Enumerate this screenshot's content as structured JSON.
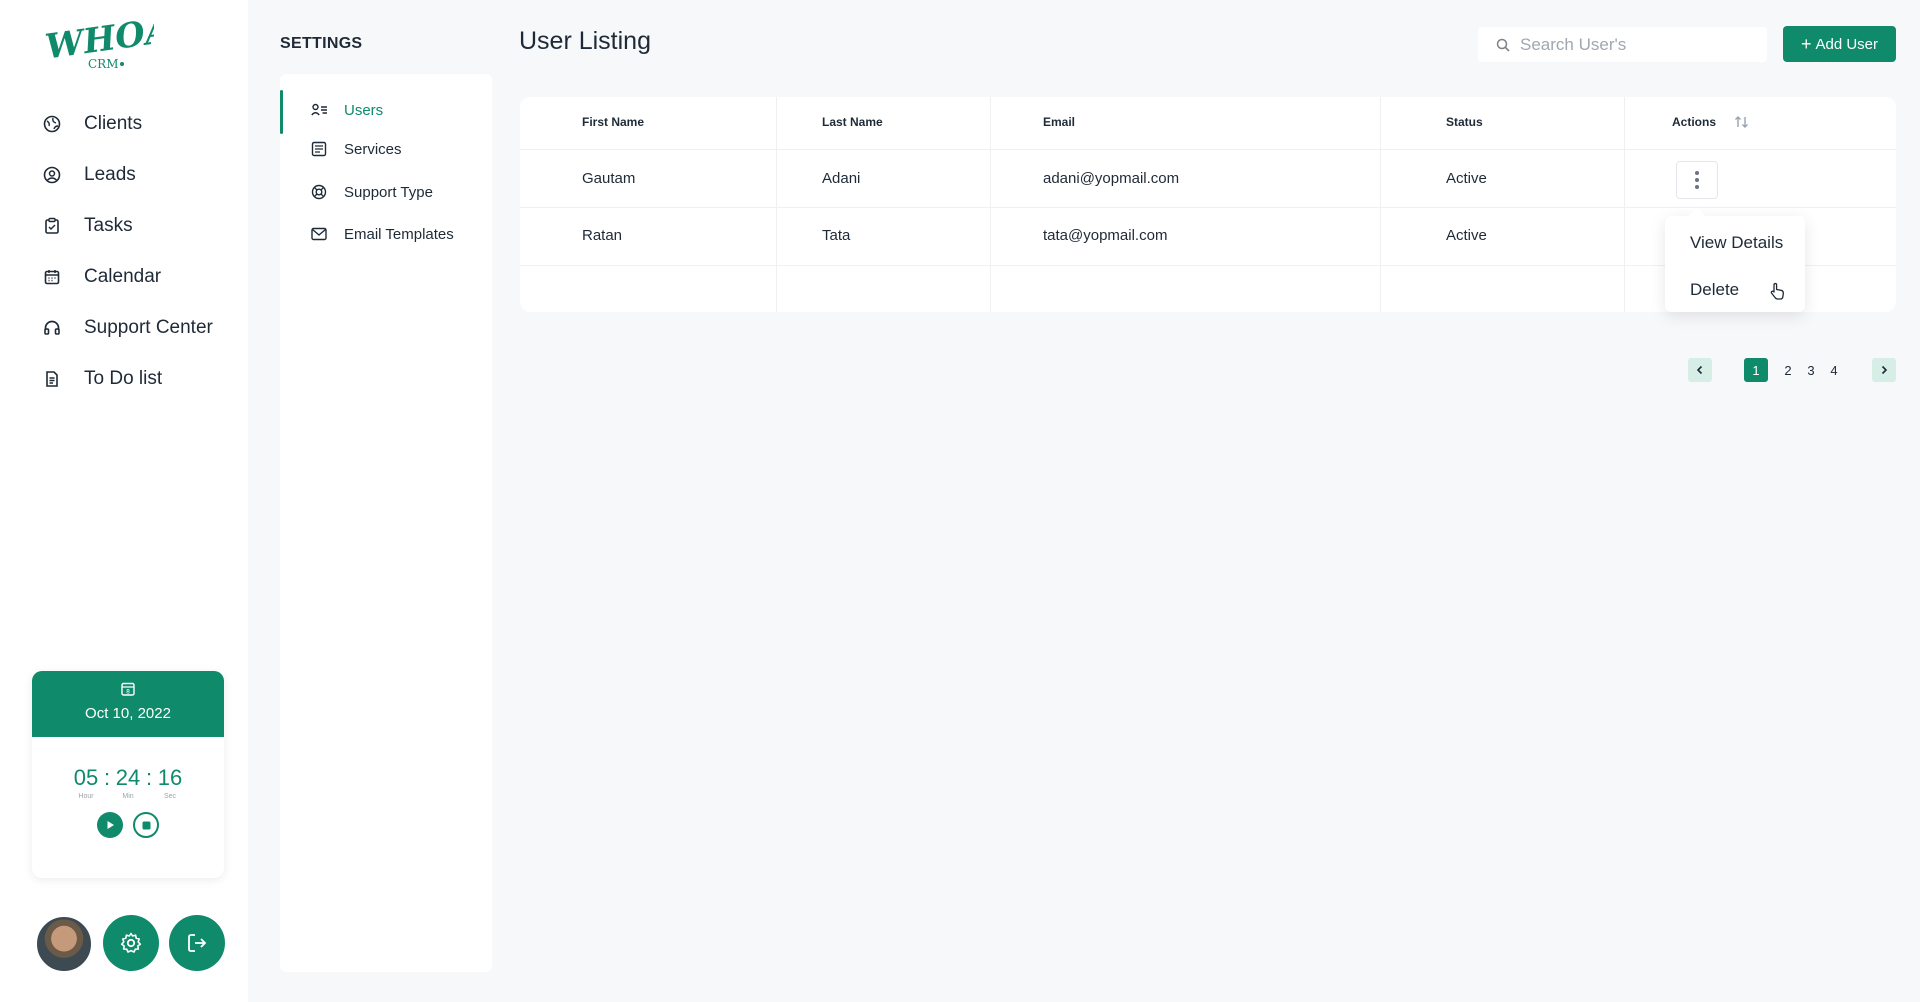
{
  "brand": {
    "logo_text": "WHOA!",
    "logo_sub": "CRM",
    "color": "#0f8a6a"
  },
  "sidebar": {
    "items": [
      {
        "label": "Clients",
        "icon": "globe-icon"
      },
      {
        "label": "Leads",
        "icon": "user-circle-icon"
      },
      {
        "label": "Tasks",
        "icon": "clipboard-check-icon"
      },
      {
        "label": "Calendar",
        "icon": "calendar-icon"
      },
      {
        "label": "Support Center",
        "icon": "headset-icon"
      },
      {
        "label": "To Do list",
        "icon": "document-icon"
      }
    ]
  },
  "timer": {
    "date": "Oct 10, 2022",
    "hours": "05",
    "minutes": "24",
    "seconds": "16",
    "hour_label": "Hour",
    "min_label": "Min",
    "sec_label": "Sec"
  },
  "settings": {
    "title": "SETTINGS",
    "items": [
      {
        "label": "Users",
        "icon": "users-list-icon",
        "active": true
      },
      {
        "label": "Services",
        "icon": "list-box-icon",
        "active": false
      },
      {
        "label": "Support Type",
        "icon": "lifebuoy-icon",
        "active": false
      },
      {
        "label": "Email Templates",
        "icon": "mail-icon",
        "active": false
      }
    ]
  },
  "main": {
    "title": "User Listing",
    "search_placeholder": "Search User's",
    "add_user_label": "Add User",
    "table": {
      "columns": [
        "First Name",
        "Last Name",
        "Email",
        "Status",
        "Actions"
      ],
      "rows": [
        {
          "first": "Gautam",
          "last": "Adani",
          "email": "adani@yopmail.com",
          "status": "Active"
        },
        {
          "first": "Ratan",
          "last": "Tata",
          "email": "tata@yopmail.com",
          "status": "Active"
        }
      ]
    },
    "actions_menu": {
      "view": "View Details",
      "delete": "Delete"
    },
    "pagination": {
      "pages": [
        "1",
        "2",
        "3",
        "4"
      ],
      "current": "1"
    }
  }
}
